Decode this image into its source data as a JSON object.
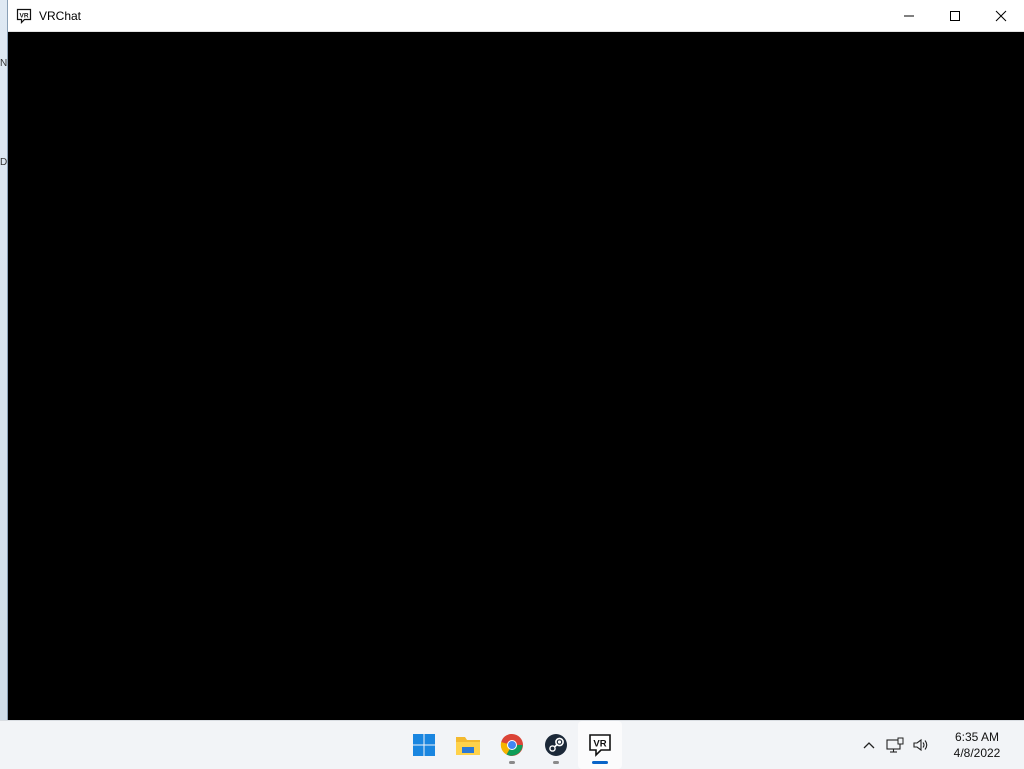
{
  "window": {
    "title": "VRChat",
    "app_icon": "vrchat-icon",
    "controls": [
      "minimize-icon",
      "maximize-icon",
      "close-icon"
    ]
  },
  "desktop": {
    "edge_glyphs": [
      "N",
      "D"
    ]
  },
  "taskbar": {
    "apps": [
      {
        "name": "start",
        "icon": "windows-start-icon",
        "running": false,
        "active": false
      },
      {
        "name": "file-explorer",
        "icon": "folder-icon",
        "running": false,
        "active": false
      },
      {
        "name": "chrome",
        "icon": "chrome-icon",
        "running": true,
        "active": false
      },
      {
        "name": "steam",
        "icon": "steam-icon",
        "running": true,
        "active": false
      },
      {
        "name": "vrchat",
        "icon": "vrchat-icon",
        "running": true,
        "active": true
      }
    ],
    "tray": {
      "icons": [
        "chevron-up-icon",
        "network-icon",
        "volume-icon"
      ],
      "time": "6:35 AM",
      "date": "4/8/2022"
    }
  },
  "colors": {
    "accent": "#0a64c8",
    "client_background": "#000000"
  }
}
